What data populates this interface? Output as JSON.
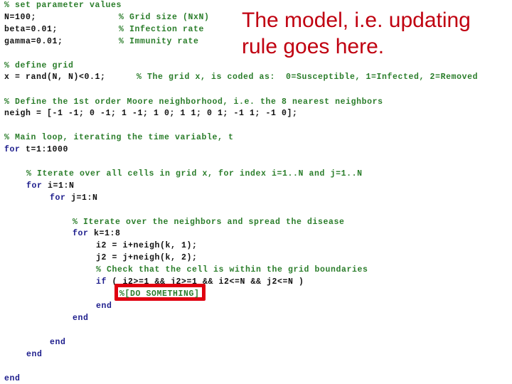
{
  "annotation": {
    "line1": "The model, i.e. updating",
    "line2": "rule goes here."
  },
  "code": {
    "c_params": "% set parameter values",
    "n_code": "N=100;",
    "n_comment": "% Grid size (NxN)",
    "beta_code": "beta=0.01;",
    "beta_comment": "% Infection rate",
    "gamma_code": "gamma=0.01;",
    "gamma_comment": "% Immunity rate",
    "c_grid": "% define grid",
    "x_code": "x = rand(N, N)<0.1;",
    "x_comment": "% The grid x, is coded as:  0=Susceptible, 1=Infected, 2=Removed",
    "c_neigh": "% Define the 1st order Moore neighborhood, i.e. the 8 nearest neighbors",
    "neigh_code": "neigh = [-1 -1; 0 -1; 1 -1; 1 0; 1 1; 0 1; -1 1; -1 0];",
    "c_main": "% Main loop, iterating the time variable, t",
    "for_kw": "for",
    "for_t": " t=1:1000",
    "c_iter": "% Iterate over all cells in grid x, for index i=1..N and j=1..N",
    "for_i": " i=1:N",
    "for_j": " j=1:N",
    "c_neighbors": "% Iterate over the neighbors and spread the disease",
    "for_k": " k=1:8",
    "i2_code": "i2 = i+neigh(k, 1);",
    "j2_code": "j2 = j+neigh(k, 2);",
    "c_check": "% Check that the cell is within the grid boundaries",
    "if_kw": "if",
    "if_cond": " ( i2>=1 && j2>=1 && i2<=N && j2<=N )",
    "placeholder": "%[DO SOMETHING]",
    "end_kw": "end"
  }
}
